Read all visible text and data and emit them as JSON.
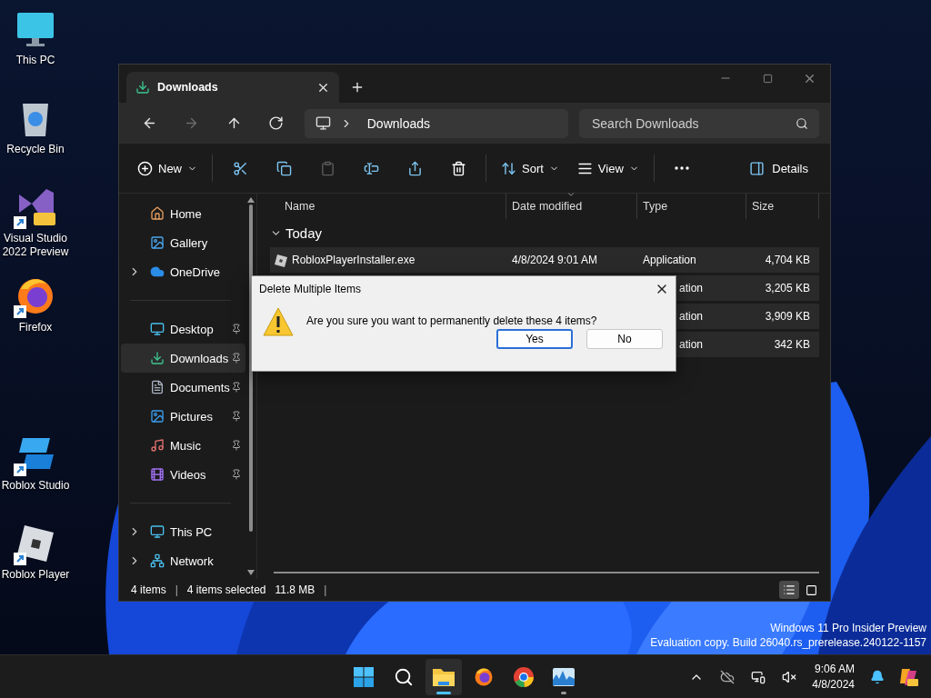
{
  "desktop_icon_groups": [
    [
      {
        "label": "This PC",
        "kind": "pc",
        "shortcut": false
      },
      {
        "label": "Recycle Bin",
        "kind": "recycle",
        "shortcut": false
      },
      {
        "label": "Visual Studio 2022 Preview",
        "kind": "vs",
        "shortcut": true
      },
      {
        "label": "Firefox",
        "kind": "firefox",
        "shortcut": true
      }
    ],
    [
      {
        "label": "Roblox Studio",
        "kind": "studio",
        "shortcut": true
      },
      {
        "label": "Roblox Player",
        "kind": "player",
        "shortcut": true
      }
    ]
  ],
  "explorer": {
    "tab": {
      "title": "Downloads"
    },
    "nav_buttons": [
      {
        "kind": "back",
        "disabled": false
      },
      {
        "kind": "forward",
        "disabled": true
      },
      {
        "kind": "up",
        "disabled": false
      },
      {
        "kind": "refresh",
        "disabled": false
      }
    ],
    "address": {
      "path": "Downloads"
    },
    "search": {
      "placeholder": "Search Downloads"
    },
    "commands": [
      {
        "kind": "new",
        "label": "New",
        "disabled": false
      },
      {
        "kind": "cut",
        "disabled": false
      },
      {
        "kind": "copy",
        "disabled": false
      },
      {
        "kind": "paste",
        "disabled": true
      },
      {
        "kind": "rename",
        "disabled": false
      },
      {
        "kind": "share",
        "disabled": false
      },
      {
        "kind": "delete",
        "disabled": false
      },
      {
        "kind": "sort",
        "label": "Sort",
        "disabled": false
      },
      {
        "kind": "view",
        "label": "View",
        "disabled": false
      },
      {
        "kind": "more",
        "disabled": false
      }
    ],
    "details_button": "Details",
    "nav_sections": [
      [
        {
          "label": "Home",
          "kind": "home",
          "expandable": false,
          "pinned": false,
          "selected": false
        },
        {
          "label": "Gallery",
          "kind": "gallery",
          "expandable": false,
          "pinned": false,
          "selected": false
        },
        {
          "label": "OneDrive",
          "kind": "onedrive",
          "expandable": true,
          "pinned": false,
          "selected": false
        }
      ],
      [
        {
          "label": "Desktop",
          "kind": "desktop",
          "expandable": false,
          "pinned": true,
          "selected": false
        },
        {
          "label": "Downloads",
          "kind": "downloads",
          "expandable": false,
          "pinned": true,
          "selected": true
        },
        {
          "label": "Documents",
          "kind": "documents",
          "expandable": false,
          "pinned": true,
          "selected": false
        },
        {
          "label": "Pictures",
          "kind": "pictures",
          "expandable": false,
          "pinned": true,
          "selected": false
        },
        {
          "label": "Music",
          "kind": "music",
          "expandable": false,
          "pinned": true,
          "selected": false
        },
        {
          "label": "Videos",
          "kind": "videos",
          "expandable": false,
          "pinned": true,
          "selected": false
        }
      ],
      [
        {
          "label": "This PC",
          "kind": "thispc",
          "expandable": true,
          "pinned": false,
          "selected": false
        },
        {
          "label": "Network",
          "kind": "network",
          "expandable": true,
          "pinned": false,
          "selected": false
        }
      ]
    ],
    "columns": [
      {
        "label": "Name",
        "sorted": false
      },
      {
        "label": "Date modified",
        "sorted": true
      },
      {
        "label": "Type",
        "sorted": false
      },
      {
        "label": "Size",
        "sorted": false
      }
    ],
    "group": {
      "label": "Today",
      "expanded": true
    },
    "rows": [
      {
        "name": "RobloxPlayerInstaller.exe",
        "date": "4/8/2024 9:01 AM",
        "type": "Application",
        "size": "4,704 KB",
        "selected": true
      },
      {
        "type": "ation",
        "size": "3,205 KB",
        "selected": true
      },
      {
        "type": "ation",
        "size": "3,909 KB",
        "selected": true
      },
      {
        "type": "ation",
        "size": "342 KB",
        "selected": true
      }
    ],
    "status": [
      {
        "kind": "item-count",
        "text": "4 items"
      },
      {
        "kind": "divider",
        "text": "|"
      },
      {
        "kind": "selection-count",
        "text": "4 items selected"
      },
      {
        "kind": "selection-size",
        "text": "11.8 MB"
      },
      {
        "kind": "divider",
        "text": "|"
      }
    ],
    "view_buttons": [
      {
        "kind": "details",
        "selected": true
      },
      {
        "kind": "tiles",
        "selected": false
      }
    ]
  },
  "dialog": {
    "title": "Delete Multiple Items",
    "message": "Are you sure you want to permanently delete these 4 items?",
    "buttons": [
      {
        "label": "Yes",
        "selected": true
      },
      {
        "label": "No",
        "selected": false
      }
    ]
  },
  "desktop_notice": [
    "Windows 11 Pro Insider Preview",
    "Evaluation copy. Build 26040.rs_prerelease.240122-1157"
  ],
  "taskbar": {
    "apps": [
      {
        "kind": "start",
        "active": false
      },
      {
        "kind": "search",
        "active": false
      },
      {
        "kind": "explorer",
        "active": true
      },
      {
        "kind": "firefox",
        "active": false
      },
      {
        "kind": "chrome",
        "active": false
      },
      {
        "kind": "monitor",
        "active": false
      }
    ],
    "clock": {
      "time": "9:06 AM",
      "date": "4/8/2024"
    }
  }
}
